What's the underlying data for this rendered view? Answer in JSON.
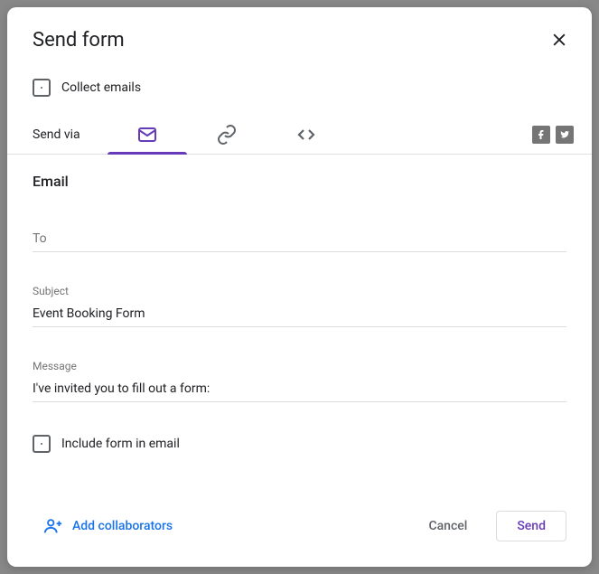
{
  "dialog": {
    "title": "Send form",
    "collect_emails_label": "Collect emails",
    "send_via_label": "Send via",
    "section_title": "Email",
    "to_placeholder": "To",
    "subject_label": "Subject",
    "subject_value": "Event Booking Form",
    "message_label": "Message",
    "message_value": "I've invited you to fill out a form:",
    "include_form_label": "Include form in email",
    "add_collaborators_label": "Add collaborators",
    "cancel_label": "Cancel",
    "send_label": "Send"
  }
}
